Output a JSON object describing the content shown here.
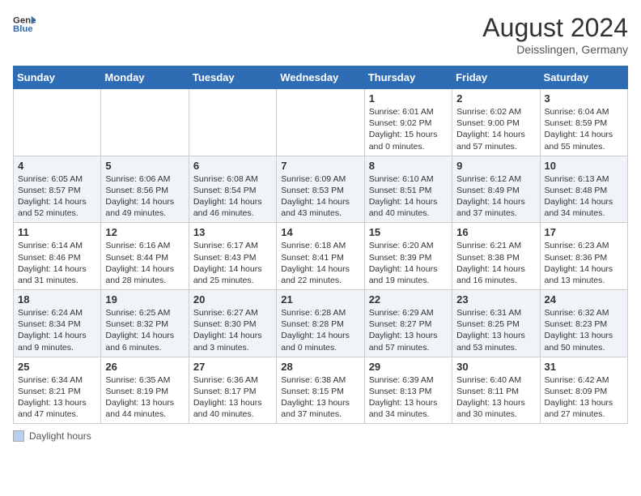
{
  "logo": {
    "line1": "General",
    "line2": "Blue"
  },
  "title": {
    "month_year": "August 2024",
    "location": "Deisslingen, Germany"
  },
  "days_of_week": [
    "Sunday",
    "Monday",
    "Tuesday",
    "Wednesday",
    "Thursday",
    "Friday",
    "Saturday"
  ],
  "weeks": [
    [
      {
        "day": "",
        "info": ""
      },
      {
        "day": "",
        "info": ""
      },
      {
        "day": "",
        "info": ""
      },
      {
        "day": "",
        "info": ""
      },
      {
        "day": "1",
        "info": "Sunrise: 6:01 AM\nSunset: 9:02 PM\nDaylight: 15 hours\nand 0 minutes."
      },
      {
        "day": "2",
        "info": "Sunrise: 6:02 AM\nSunset: 9:00 PM\nDaylight: 14 hours\nand 57 minutes."
      },
      {
        "day": "3",
        "info": "Sunrise: 6:04 AM\nSunset: 8:59 PM\nDaylight: 14 hours\nand 55 minutes."
      }
    ],
    [
      {
        "day": "4",
        "info": "Sunrise: 6:05 AM\nSunset: 8:57 PM\nDaylight: 14 hours\nand 52 minutes."
      },
      {
        "day": "5",
        "info": "Sunrise: 6:06 AM\nSunset: 8:56 PM\nDaylight: 14 hours\nand 49 minutes."
      },
      {
        "day": "6",
        "info": "Sunrise: 6:08 AM\nSunset: 8:54 PM\nDaylight: 14 hours\nand 46 minutes."
      },
      {
        "day": "7",
        "info": "Sunrise: 6:09 AM\nSunset: 8:53 PM\nDaylight: 14 hours\nand 43 minutes."
      },
      {
        "day": "8",
        "info": "Sunrise: 6:10 AM\nSunset: 8:51 PM\nDaylight: 14 hours\nand 40 minutes."
      },
      {
        "day": "9",
        "info": "Sunrise: 6:12 AM\nSunset: 8:49 PM\nDaylight: 14 hours\nand 37 minutes."
      },
      {
        "day": "10",
        "info": "Sunrise: 6:13 AM\nSunset: 8:48 PM\nDaylight: 14 hours\nand 34 minutes."
      }
    ],
    [
      {
        "day": "11",
        "info": "Sunrise: 6:14 AM\nSunset: 8:46 PM\nDaylight: 14 hours\nand 31 minutes."
      },
      {
        "day": "12",
        "info": "Sunrise: 6:16 AM\nSunset: 8:44 PM\nDaylight: 14 hours\nand 28 minutes."
      },
      {
        "day": "13",
        "info": "Sunrise: 6:17 AM\nSunset: 8:43 PM\nDaylight: 14 hours\nand 25 minutes."
      },
      {
        "day": "14",
        "info": "Sunrise: 6:18 AM\nSunset: 8:41 PM\nDaylight: 14 hours\nand 22 minutes."
      },
      {
        "day": "15",
        "info": "Sunrise: 6:20 AM\nSunset: 8:39 PM\nDaylight: 14 hours\nand 19 minutes."
      },
      {
        "day": "16",
        "info": "Sunrise: 6:21 AM\nSunset: 8:38 PM\nDaylight: 14 hours\nand 16 minutes."
      },
      {
        "day": "17",
        "info": "Sunrise: 6:23 AM\nSunset: 8:36 PM\nDaylight: 14 hours\nand 13 minutes."
      }
    ],
    [
      {
        "day": "18",
        "info": "Sunrise: 6:24 AM\nSunset: 8:34 PM\nDaylight: 14 hours\nand 9 minutes."
      },
      {
        "day": "19",
        "info": "Sunrise: 6:25 AM\nSunset: 8:32 PM\nDaylight: 14 hours\nand 6 minutes."
      },
      {
        "day": "20",
        "info": "Sunrise: 6:27 AM\nSunset: 8:30 PM\nDaylight: 14 hours\nand 3 minutes."
      },
      {
        "day": "21",
        "info": "Sunrise: 6:28 AM\nSunset: 8:28 PM\nDaylight: 14 hours\nand 0 minutes."
      },
      {
        "day": "22",
        "info": "Sunrise: 6:29 AM\nSunset: 8:27 PM\nDaylight: 13 hours\nand 57 minutes."
      },
      {
        "day": "23",
        "info": "Sunrise: 6:31 AM\nSunset: 8:25 PM\nDaylight: 13 hours\nand 53 minutes."
      },
      {
        "day": "24",
        "info": "Sunrise: 6:32 AM\nSunset: 8:23 PM\nDaylight: 13 hours\nand 50 minutes."
      }
    ],
    [
      {
        "day": "25",
        "info": "Sunrise: 6:34 AM\nSunset: 8:21 PM\nDaylight: 13 hours\nand 47 minutes."
      },
      {
        "day": "26",
        "info": "Sunrise: 6:35 AM\nSunset: 8:19 PM\nDaylight: 13 hours\nand 44 minutes."
      },
      {
        "day": "27",
        "info": "Sunrise: 6:36 AM\nSunset: 8:17 PM\nDaylight: 13 hours\nand 40 minutes."
      },
      {
        "day": "28",
        "info": "Sunrise: 6:38 AM\nSunset: 8:15 PM\nDaylight: 13 hours\nand 37 minutes."
      },
      {
        "day": "29",
        "info": "Sunrise: 6:39 AM\nSunset: 8:13 PM\nDaylight: 13 hours\nand 34 minutes."
      },
      {
        "day": "30",
        "info": "Sunrise: 6:40 AM\nSunset: 8:11 PM\nDaylight: 13 hours\nand 30 minutes."
      },
      {
        "day": "31",
        "info": "Sunrise: 6:42 AM\nSunset: 8:09 PM\nDaylight: 13 hours\nand 27 minutes."
      }
    ]
  ],
  "legend": {
    "label": "Daylight hours"
  }
}
